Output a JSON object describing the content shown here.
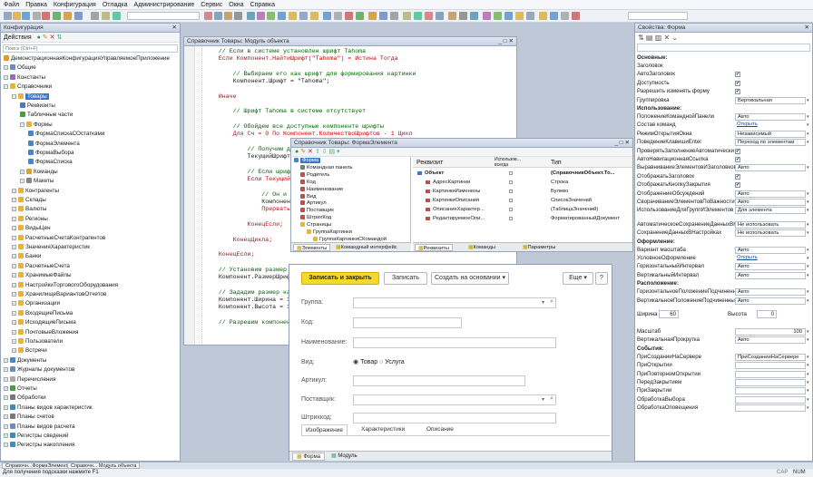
{
  "menu": [
    "Файл",
    "Правка",
    "Конфигурация",
    "Отладка",
    "Администрирование",
    "Сервис",
    "Окна",
    "Справка"
  ],
  "left_panel": {
    "title": "Конфигурация",
    "actions": "Действия",
    "search_placeholder": "Поиск (Ctrl+F)",
    "tree": [
      "ДемонстрационнаяКонфигурацияУправляемоеПриложение",
      "Общие",
      "Константы",
      "Справочники",
      "Товары",
      "Реквизиты",
      "Табличные части",
      "Формы",
      "ФормаСпискаСОстатками",
      "ФормаЭлемента",
      "ФормаВыбора",
      "ФормаСписка",
      "Команды",
      "Макеты",
      "Контрагенты",
      "Склады",
      "Валюты",
      "Регионы",
      "ВидыЦен",
      "РасчетныеСчетаКонтрагентов",
      "ЗначенияХарактеристик",
      "Банки",
      "РасчетныеСчета",
      "ХранимыеФайлы",
      "НастройкиТорговогоОборудования",
      "ХранилищеВариантовОтчетов",
      "Организации",
      "ВходящиеПисьма",
      "ИсходящиеПисьма",
      "ПочтовыеВложения",
      "Пользователи",
      "Встречи",
      "Документы",
      "Журналы документов",
      "Перечисления",
      "Отчеты",
      "Обработки",
      "Планы видов характеристик",
      "Планы счетов",
      "Планы видов расчета",
      "Регистры сведений",
      "Регистры накопления"
    ]
  },
  "code_window": {
    "title": "Справочник Товары: Модуль объекта",
    "lines": [
      "    // Если в системе установлен шрифт Tahoma",
      "    Если Компонент.НайтиШрифт(\"Tahoma\") = Истина Тогда",
      "",
      "        // Выбираем его как шрифт для формирования картинки",
      "        Компонент.Шрифт = \"Tahoma\";",
      "",
      "    Иначе",
      "",
      "        // Шрифт Tahoma в системе отсутствует",
      "",
      "        // Обойдем все доступные компоненте шрифты",
      "        Для Сч = 0 По Компонент.КоличествоШрифтов - 1 Цикл",
      "",
      "            // Получим доступный компоненте шрифт",
      "            ТекущийШрифт = Компонент.ВыбратьШрифт(Сч);",
      "",
      "            // Если шрифт доступен",
      "            Если ТекущийШрифт <> Неопределено Тогда",
      "",
      "                // Он и будет шрифтом",
      "                Компонент.Шрифт = ТекущийШрифт;",
      "                Прервать;",
      "",
      "            КонецЕсли;",
      "",
      "        КонецЦикла;",
      "",
      "    КонецЕсли;",
      "",
      "    // Установим размер шрифта",
      "    Компонент.РазмерШрифта = 12;",
      "",
      "    // Зададим размер картинки",
      "    Компонент.Ширина = 100;",
      "    Компонент.Высота = 100;",
      "",
      "    // Разрешим компоненте"
    ]
  },
  "form_designer": {
    "title": "Справочник Товары: ФормаЭлемента",
    "tree": [
      "Форма",
      "Командная панель",
      "Родитель",
      "Код",
      "Наименование",
      "Вид",
      "Артикул",
      "Поставщик",
      "ШтрихКод",
      "Страницы",
      "ГруппаКартинки",
      "ГруппаКартинкиСКомандой"
    ],
    "attr_header": [
      "Реквизит",
      "Использов... всегда",
      "Тип"
    ],
    "attrs": [
      {
        "name": "Объект",
        "type": "(СправочникОбъект.То..."
      },
      {
        "name": "АдресКартинки",
        "type": "Строка"
      },
      {
        "name": "КартинкиИзменены",
        "type": "Булево"
      },
      {
        "name": "КартинкиОписания",
        "type": "СписокЗначений"
      },
      {
        "name": "ОписаниеХарактер...",
        "type": "(ТаблицаЗначений)"
      },
      {
        "name": "РедактируемоеОпи...",
        "type": "ФорматированныйДокумент"
      }
    ],
    "tabs_left": [
      "Элементы",
      "Командный интерфейс"
    ],
    "tabs_right": [
      "Реквизиты",
      "Команды",
      "Параметры"
    ]
  },
  "form_preview": {
    "btn_save_close": "Записать и закрыть",
    "btn_save": "Записать",
    "btn_create_based": "Создать на основании",
    "btn_more": "Еще",
    "btn_help": "?",
    "fields": [
      "Группа:",
      "Код:",
      "Наименование:",
      "Вид:",
      "Артикул:",
      "Поставщик:",
      "Штрихкод:"
    ],
    "radio1": "Товар",
    "radio2": "Услуга",
    "tabs": [
      "Изображение",
      "Характеристики",
      "Описание"
    ],
    "bottom_tabs": [
      "Форма",
      "Модуль"
    ]
  },
  "props": {
    "title": "Свойства: Форма",
    "rows": [
      {
        "t": "sec",
        "l": "Основные:"
      },
      {
        "l": "Заголовок"
      },
      {
        "l": "АвтоЗаголовок",
        "c": true
      },
      {
        "l": "Доступность",
        "c": true
      },
      {
        "l": "Разрешить изменять форму",
        "c": true
      },
      {
        "l": "Группировка",
        "v": "Вертикальная"
      },
      {
        "t": "sec",
        "l": "Использование:"
      },
      {
        "l": "ПоложениеКоманднойПанели",
        "v": "Авто"
      },
      {
        "l": "Состав команд",
        "v": "Открыть",
        "link": true
      },
      {
        "l": "РежимОткрытияОкна",
        "v": "Независимый"
      },
      {
        "l": "ПоведениеКлавишиEnter",
        "v": "Переход по элементам"
      },
      {
        "l": "ПроверятьЗаполнениеАвтоматически",
        "c": true
      },
      {
        "l": "АвтоНавигационнаяСсылка",
        "c": true
      },
      {
        "l": "ВыравниваниеЭлементовИЗаголовков",
        "v": "Авто"
      },
      {
        "l": "ОтображатьЗаголовок",
        "c": true
      },
      {
        "l": "ОтображатьКнопкуЗакрытия",
        "c": true
      },
      {
        "l": "ОтображениеОбсуждений",
        "v": "Авто"
      },
      {
        "l": "СворачиваниеЭлементовПоВажности",
        "v": "Авто"
      },
      {
        "l": "ИспользованиеДляГруппИЭлементов",
        "v": "Для элемента"
      },
      {
        "t": "gap"
      },
      {
        "l": "АвтоматическоеСохранениеДанныхВН",
        "v": "Не использовать"
      },
      {
        "l": "СохранениеДанныхВНастройках",
        "v": "Не использовать"
      },
      {
        "t": "sec",
        "l": "Оформление:"
      },
      {
        "l": "Вариант масштаба",
        "v": "Авто"
      },
      {
        "l": "УсловноеОформление",
        "v": "Открыть",
        "link": true
      },
      {
        "l": "ГоризонтальныйИнтервал",
        "v": "Авто"
      },
      {
        "l": "ВертикальныйИнтервал",
        "v": "Авто"
      },
      {
        "t": "sec",
        "l": "Расположение:"
      },
      {
        "l": "ГоризонтальноеПоложениеПодчиненных",
        "v": "Авто"
      },
      {
        "l": "ВертикальноеПоложениеПодчиненных",
        "v": "Авто"
      },
      {
        "t": "gap"
      },
      {
        "t": "wh",
        "l": "Ширина",
        "v": "60",
        "l2": "Высота",
        "v2": "0"
      },
      {
        "t": "gap"
      },
      {
        "l": "Масштаб",
        "v": "100"
      },
      {
        "l": "ВертикальнаяПрокрутка",
        "v": "Авто"
      },
      {
        "t": "sec",
        "l": "События:"
      },
      {
        "l": "ПриСозданииНаСервере",
        "v": "ПриСозданииНаСервере"
      },
      {
        "l": "ПриОткрытии"
      },
      {
        "l": "ПриПовторномОткрытии"
      },
      {
        "l": "ПередЗакрытием"
      },
      {
        "l": "ПриЗакрытии"
      },
      {
        "l": "ОбработкаВыбора"
      },
      {
        "l": "ОбработкаОповещения"
      }
    ]
  },
  "taskbar": [
    "Справочн...ФормаЭлемента",
    "Справочн... Модуль объекта"
  ],
  "status": {
    "hint": "Для получения подсказки нажмите F1",
    "caps": "CAP",
    "num": "NUM"
  }
}
